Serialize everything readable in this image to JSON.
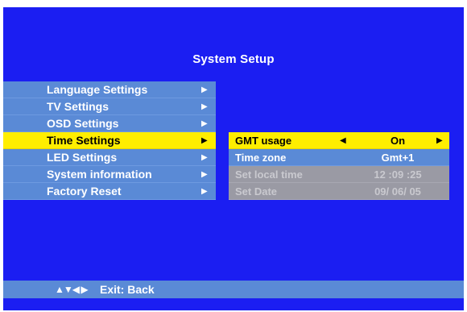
{
  "title": "System Setup",
  "menu": {
    "items": [
      {
        "label": "Language Settings",
        "arrow": "▶"
      },
      {
        "label": "TV Settings",
        "arrow": "▶"
      },
      {
        "label": "OSD Settings",
        "arrow": "▶"
      },
      {
        "label": "Time Settings",
        "arrow": "▶"
      },
      {
        "label": "LED Settings",
        "arrow": "▶"
      },
      {
        "label": "System information",
        "arrow": "▶"
      },
      {
        "label": "Factory Reset",
        "arrow": "▶"
      }
    ]
  },
  "submenu": {
    "rows": [
      {
        "label": "GMT usage",
        "value": "On",
        "left_arrow": "◀",
        "right_arrow": "▶"
      },
      {
        "label": "Time zone",
        "value": "Gmt+1"
      },
      {
        "label": "Set local time",
        "value": "12 :09 :25"
      },
      {
        "label": "Set Date",
        "value": "09/ 06/ 05"
      }
    ]
  },
  "footer": {
    "nav_icons": "▲▼◀ ▶",
    "exit_label": "Exit: Back"
  },
  "colors": {
    "background": "#1b1ef2",
    "menu_item": "#5a8ad6",
    "highlight": "#ffee00",
    "disabled": "#9a9aa4"
  }
}
